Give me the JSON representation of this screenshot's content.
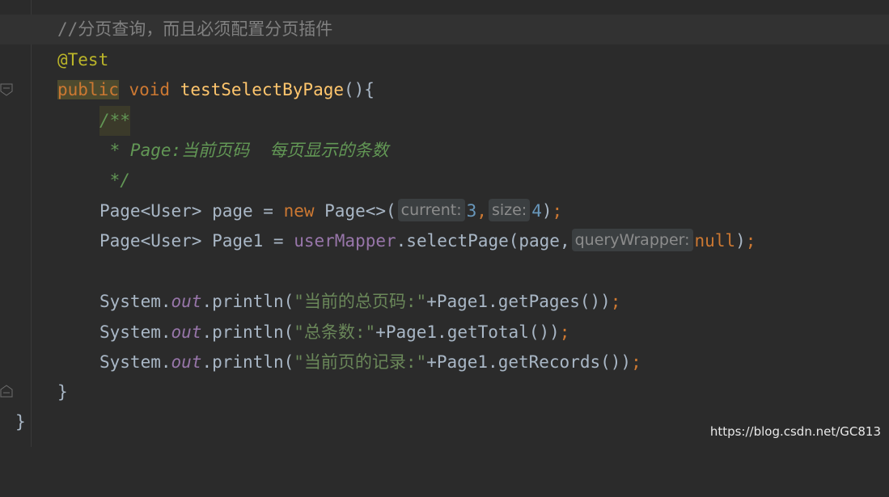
{
  "code": {
    "l1_comment": "//分页查询，而且必须配置分页插件",
    "l2_annotation": "@Test",
    "l3_public": "public",
    "l3_void": " void ",
    "l3_method": "testSelectByPage",
    "l3_rest": "(){",
    "l4_doc": "/**",
    "l5_doc": " * Page:当前页码  每页显示的条数",
    "l6_doc": " */",
    "l7_a": "Page<User> page = ",
    "l7_new": "new",
    "l7_b": " Page<>(",
    "l7_hint1": "current:",
    "l7_num1": "3",
    "l7_comma": ",",
    "l7_hint2": "size:",
    "l7_num2": "4",
    "l7_close": ")",
    "l7_semi": ";",
    "l8_a": "Page<User> Page1 = ",
    "l8_field": "userMapper",
    "l8_b": ".selectPage(page,",
    "l8_hint": "queryWrapper:",
    "l8_null": "null",
    "l8_close": ")",
    "l8_semi": ";",
    "l10_sys": "System.",
    "l10_out": "out",
    "l10_call": ".println(",
    "l10_str": "\"当前的总页码:\"",
    "l10_rest": "+Page1.getPages())",
    "l10_semi": ";",
    "l11_sys": "System.",
    "l11_out": "out",
    "l11_call": ".println(",
    "l11_str": "\"总条数:\"",
    "l11_rest": "+Page1.getTotal())",
    "l11_semi": ";",
    "l12_sys": "System.",
    "l12_out": "out",
    "l12_call": ".println(",
    "l12_str": "\"当前页的记录:\"",
    "l12_rest": "+Page1.getRecords())",
    "l12_semi": ";",
    "l13_brace": "}",
    "l14_brace": "}"
  },
  "watermark": "https://blog.csdn.net/GC813",
  "colors": {
    "background": "#2b2b2b",
    "keyword": "#cc7832",
    "string": "#6a8759",
    "number": "#6897bb",
    "method": "#ffc66d",
    "annotation": "#bbb529",
    "field": "#9876aa",
    "doc_comment": "#629755"
  },
  "icons": [
    "fold-marker-icon",
    "fold-marker-icon"
  ]
}
